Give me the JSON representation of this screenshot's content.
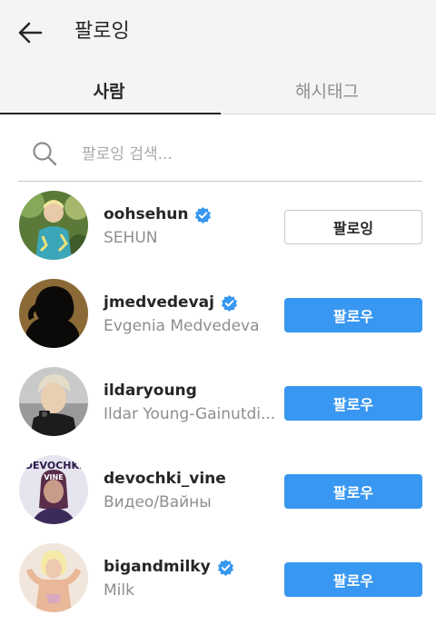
{
  "header": {
    "title": "팔로잉",
    "back_icon": "arrow-left-icon"
  },
  "tabs": [
    {
      "label": "사람",
      "active": true
    },
    {
      "label": "해시태그",
      "active": false
    }
  ],
  "search": {
    "placeholder": "팔로잉 검색...",
    "value": "",
    "icon": "search-icon"
  },
  "colors": {
    "accent": "#3897f0",
    "verified": "#3897f0",
    "text": "#262626",
    "muted": "#8e8e8e"
  },
  "users": [
    {
      "username": "oohsehun",
      "full_name": "SEHUN",
      "verified": true,
      "button": "팔로잉",
      "button_state": "following"
    },
    {
      "username": "jmedvedevaj",
      "full_name": "Evgenia Medvedeva",
      "verified": true,
      "button": "팔로우",
      "button_state": "follow"
    },
    {
      "username": "ildaryoung",
      "full_name": "Ildar Young-Gainutdi...",
      "verified": false,
      "button": "팔로우",
      "button_state": "follow"
    },
    {
      "username": "devochki_vine",
      "full_name": "Видео/Вайны",
      "verified": false,
      "button": "팔로우",
      "button_state": "follow",
      "avatar_text": "DEVOCHKI VINE"
    },
    {
      "username": "bigandmilky",
      "full_name": "Milk",
      "verified": true,
      "button": "팔로우",
      "button_state": "follow"
    }
  ]
}
